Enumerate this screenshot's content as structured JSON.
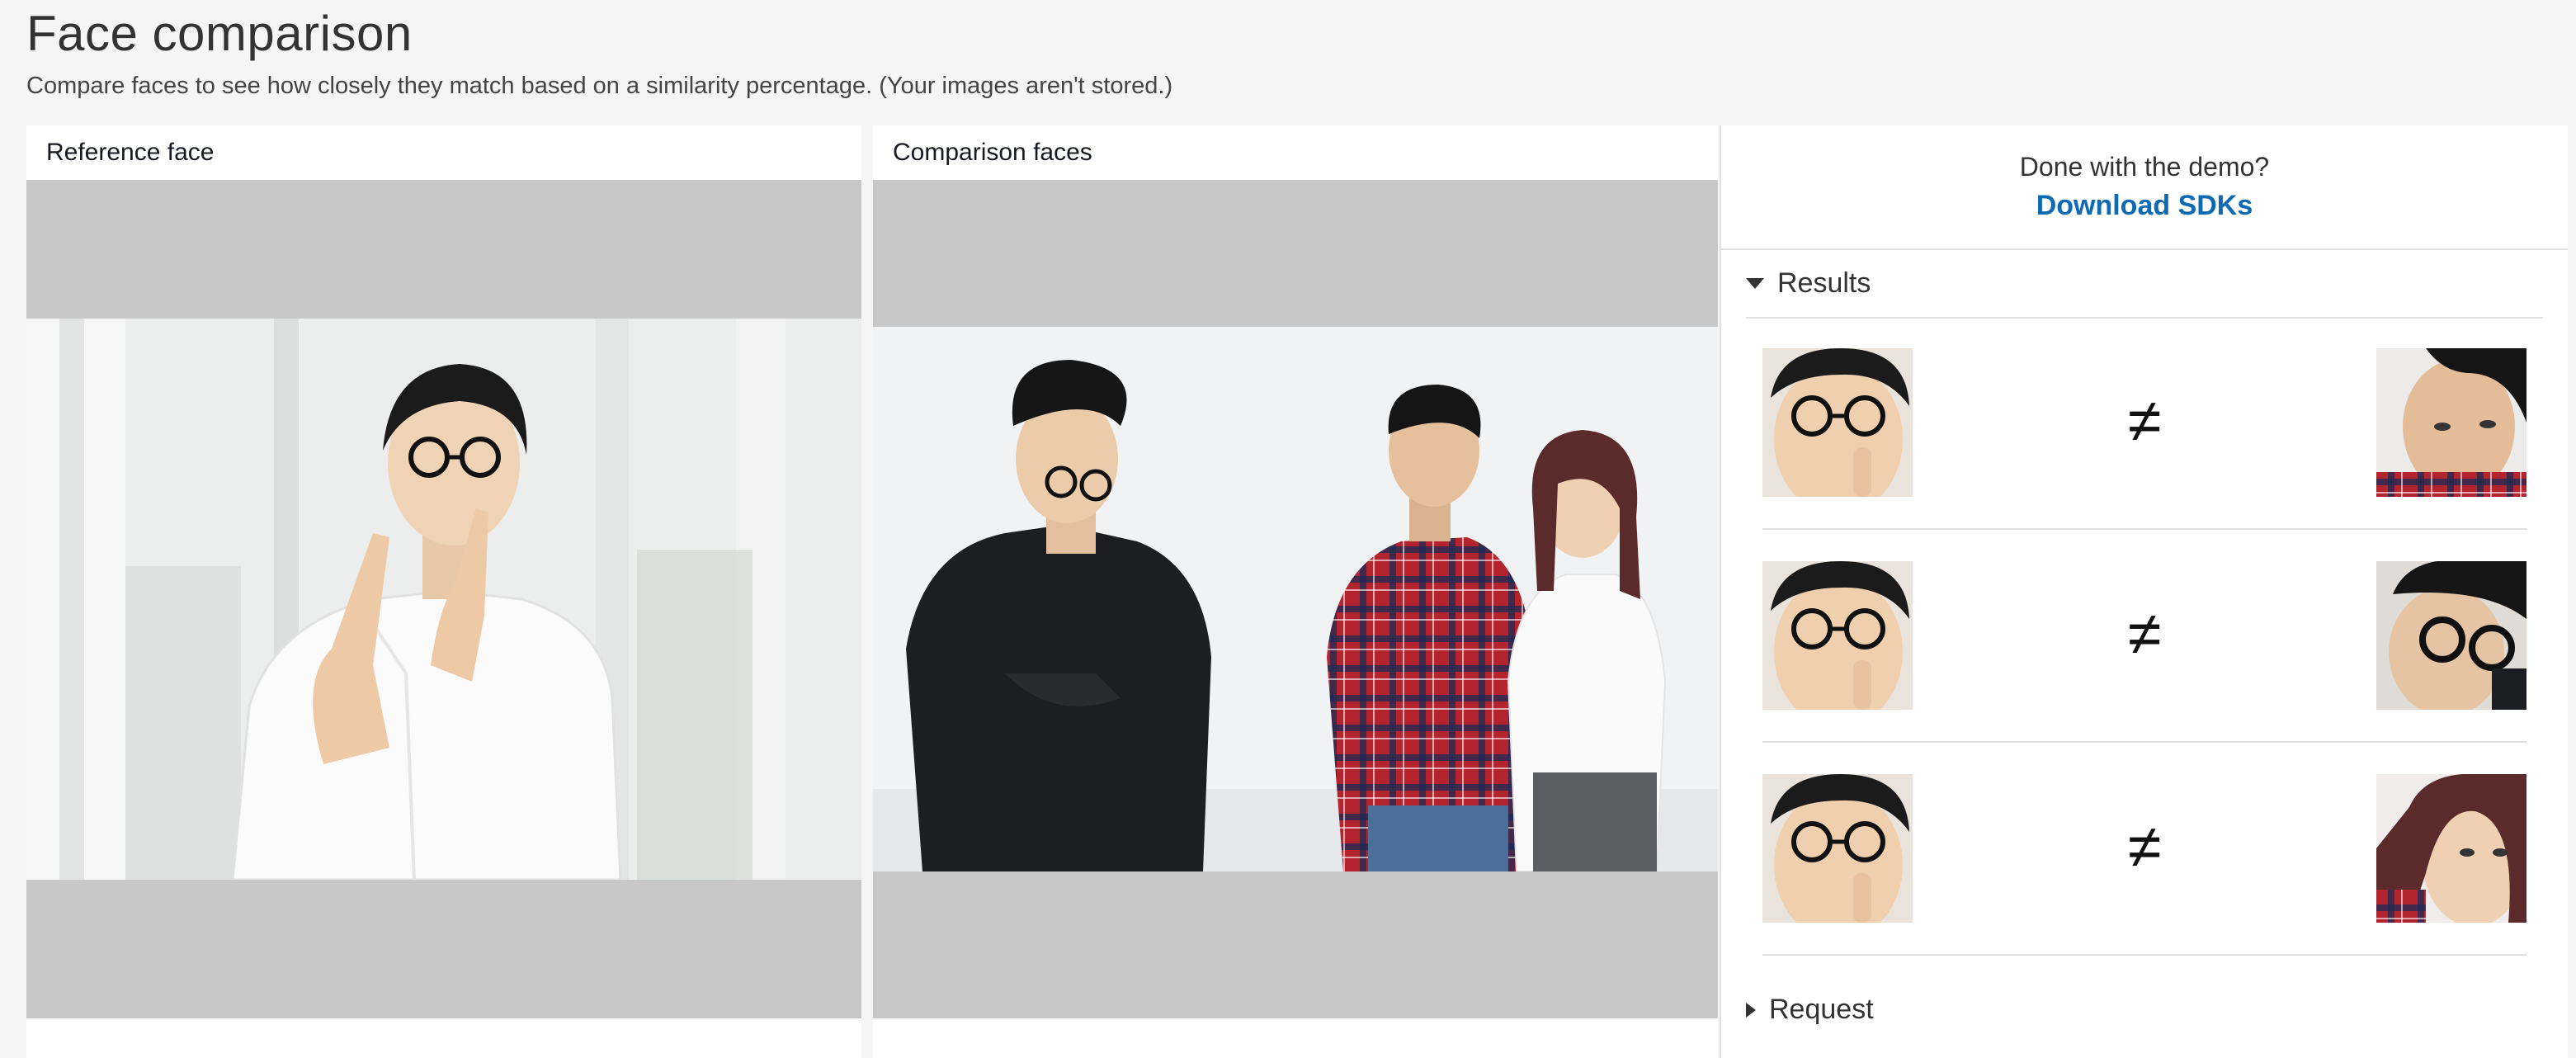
{
  "header": {
    "title": "Face comparison",
    "subtitle": "Compare faces to see how closely they match based on a similarity percentage. (Your images aren't stored.)"
  },
  "reference": {
    "label": "Reference face"
  },
  "comparison": {
    "label": "Comparison faces"
  },
  "sidebar": {
    "demo_question": "Done with the demo?",
    "download_link": "Download SDKs",
    "results_label": "Results",
    "request_label": "Request",
    "results": [
      {
        "symbol": "≠"
      },
      {
        "symbol": "≠"
      },
      {
        "symbol": "≠"
      }
    ]
  },
  "colors": {
    "link": "#0f6ab4",
    "page_background": "#f5f5f5",
    "image_placeholder": "#c8c8c8"
  }
}
